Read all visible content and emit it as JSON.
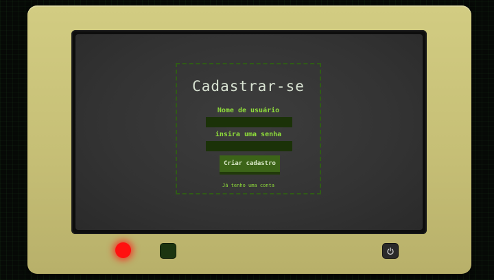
{
  "form": {
    "title": "Cadastrar-se",
    "username_label": "Nome de usuário",
    "username_value": "",
    "password_label": "insira uma senha",
    "password_value": "",
    "submit_label": "Criar cadastro",
    "login_link": "Já tenho uma conta"
  },
  "device": {
    "led_color": "#ff1010",
    "screen_color": "#333333",
    "accent": "#8edc3a",
    "buttons": [
      "power-icon"
    ]
  }
}
